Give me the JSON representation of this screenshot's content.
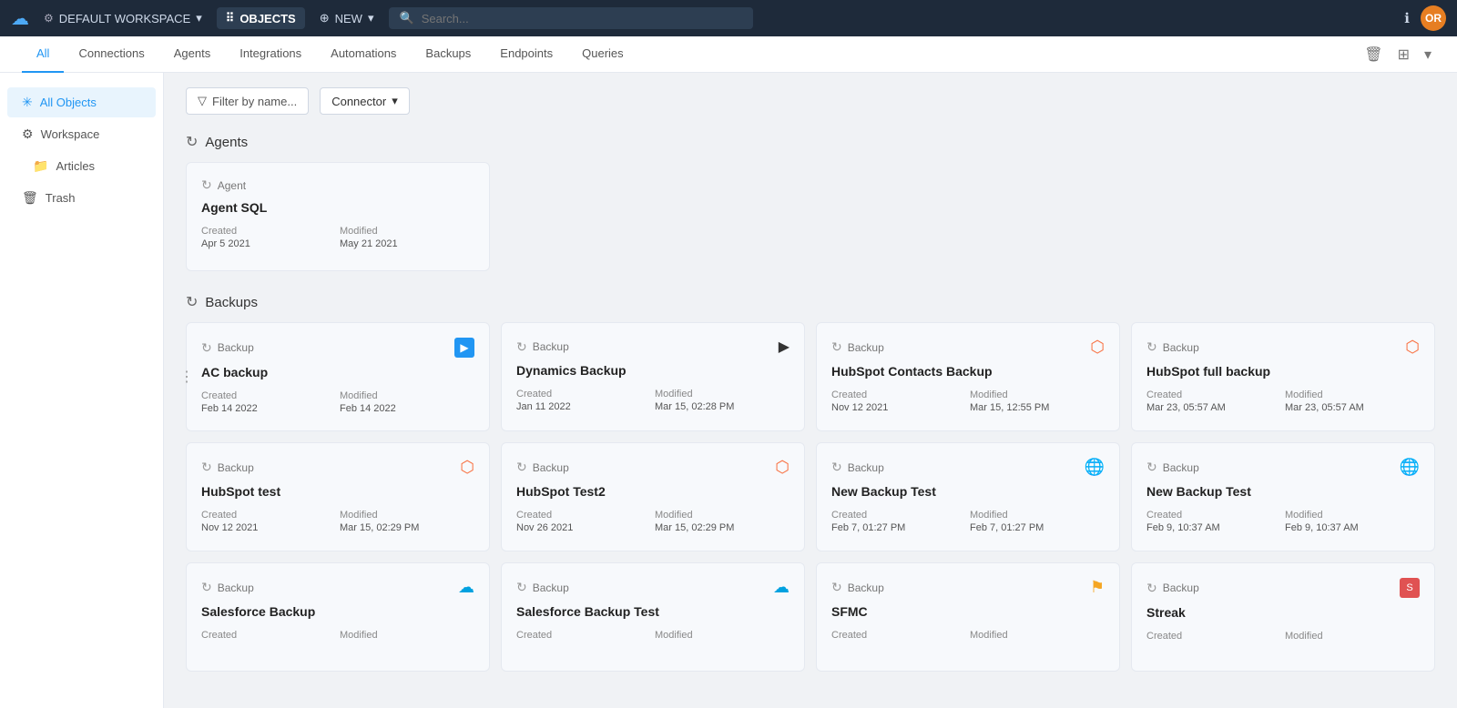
{
  "topNav": {
    "workspace": "DEFAULT WORKSPACE",
    "objects": "OBJECTS",
    "new": "NEW",
    "search_placeholder": "Search...",
    "help_label": "?",
    "avatar_initials": "OR"
  },
  "subNav": {
    "items": [
      {
        "label": "All",
        "active": true
      },
      {
        "label": "Connections",
        "active": false
      },
      {
        "label": "Agents",
        "active": false
      },
      {
        "label": "Integrations",
        "active": false
      },
      {
        "label": "Automations",
        "active": false
      },
      {
        "label": "Backups",
        "active": false
      },
      {
        "label": "Endpoints",
        "active": false
      },
      {
        "label": "Queries",
        "active": false
      }
    ]
  },
  "sidebar": {
    "items": [
      {
        "label": "All Objects",
        "icon": "✳",
        "active": true
      },
      {
        "label": "Workspace",
        "icon": "⚙",
        "active": false
      },
      {
        "label": "Articles",
        "icon": "📁",
        "active": false
      },
      {
        "label": "Trash",
        "icon": "🗑",
        "active": false
      }
    ]
  },
  "filterBar": {
    "filter_label": "Filter by name...",
    "connector_label": "Connector",
    "connector_arrow": "▾"
  },
  "sections": {
    "agents": {
      "label": "Agents",
      "cards": [
        {
          "type": "Agent",
          "title": "Agent SQL",
          "created_label": "Created",
          "created_value": "Apr 5 2021",
          "modified_label": "Modified",
          "modified_value": "May 21 2021",
          "connector_icon": ""
        }
      ]
    },
    "backups": {
      "label": "Backups",
      "cards": [
        {
          "type": "Backup",
          "title": "AC backup",
          "created_label": "Created",
          "created_value": "Feb 14 2022",
          "modified_label": "Modified",
          "modified_value": "Feb 14 2022",
          "connector_icon": "blue_arrow",
          "has_more": true
        },
        {
          "type": "Backup",
          "title": "Dynamics Backup",
          "created_label": "Created",
          "created_value": "Jan 11 2022",
          "modified_label": "Modified",
          "modified_value": "Mar 15, 02:28 PM",
          "connector_icon": "play"
        },
        {
          "type": "Backup",
          "title": "HubSpot Contacts Backup",
          "created_label": "Created",
          "created_value": "Nov 12 2021",
          "modified_label": "Modified",
          "modified_value": "Mar 15, 12:55 PM",
          "connector_icon": "hubspot"
        },
        {
          "type": "Backup",
          "title": "HubSpot full backup",
          "created_label": "Created",
          "created_value": "Mar 23, 05:57 AM",
          "modified_label": "Modified",
          "modified_value": "Mar 23, 05:57 AM",
          "connector_icon": "hubspot"
        },
        {
          "type": "Backup",
          "title": "HubSpot test",
          "created_label": "Created",
          "created_value": "Nov 12 2021",
          "modified_label": "Modified",
          "modified_value": "Mar 15, 02:29 PM",
          "connector_icon": "hubspot"
        },
        {
          "type": "Backup",
          "title": "HubSpot Test2",
          "created_label": "Created",
          "created_value": "Nov 26 2021",
          "modified_label": "Modified",
          "modified_value": "Mar 15, 02:29 PM",
          "connector_icon": "hubspot"
        },
        {
          "type": "Backup",
          "title": "New Backup Test",
          "created_label": "Created",
          "created_value": "Feb 7, 01:27 PM",
          "modified_label": "Modified",
          "modified_value": "Feb 7, 01:27 PM",
          "connector_icon": "globe_blue"
        },
        {
          "type": "Backup",
          "title": "New Backup Test",
          "created_label": "Created",
          "created_value": "Feb 9, 10:37 AM",
          "modified_label": "Modified",
          "modified_value": "Feb 9, 10:37 AM",
          "connector_icon": "globe_blue"
        },
        {
          "type": "Backup",
          "title": "Salesforce Backup",
          "created_label": "Created",
          "created_value": "",
          "modified_label": "Modified",
          "modified_value": "",
          "connector_icon": "salesforce"
        },
        {
          "type": "Backup",
          "title": "Salesforce Backup Test",
          "created_label": "Created",
          "created_value": "",
          "modified_label": "Modified",
          "modified_value": "",
          "connector_icon": "salesforce"
        },
        {
          "type": "Backup",
          "title": "SFMC",
          "created_label": "Created",
          "created_value": "",
          "modified_label": "Modified",
          "modified_value": "",
          "connector_icon": "sfmc"
        },
        {
          "type": "Backup",
          "title": "Streak",
          "created_label": "Created",
          "created_value": "",
          "modified_label": "Modified",
          "modified_value": "",
          "connector_icon": "streak"
        }
      ]
    }
  }
}
